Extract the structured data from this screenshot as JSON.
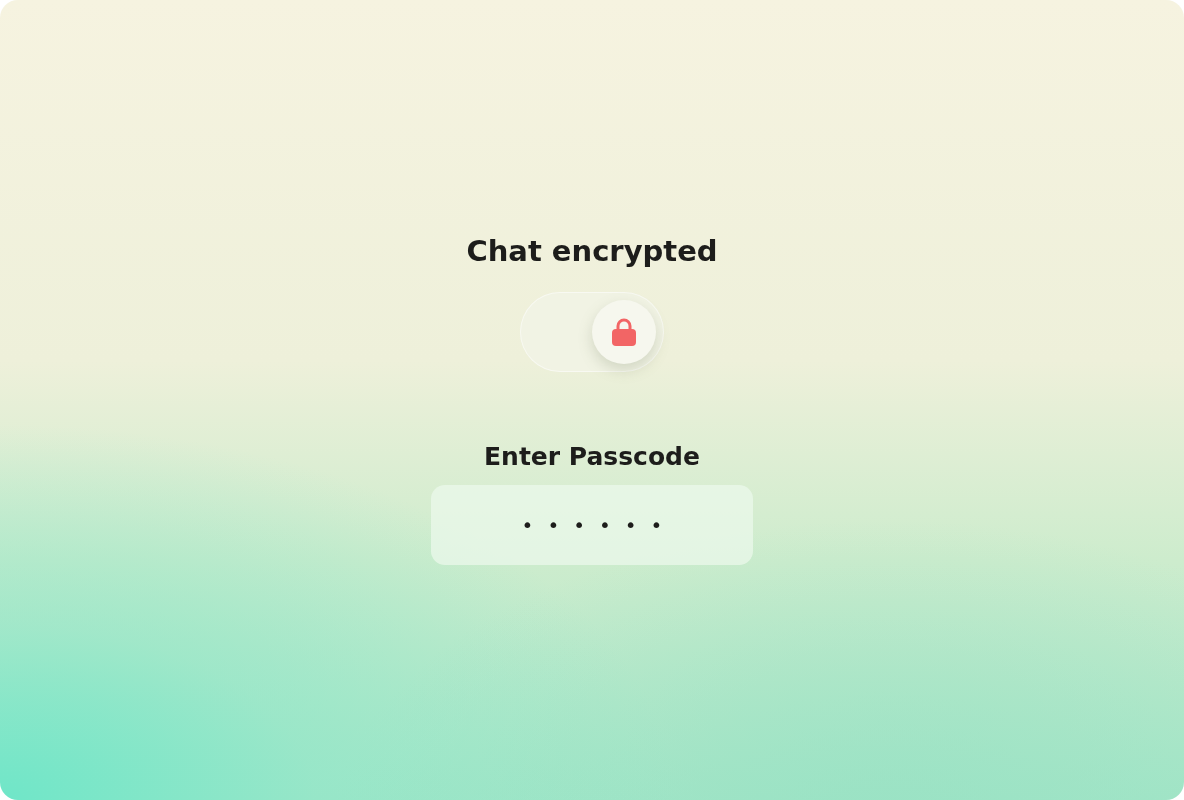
{
  "title": "Chat encrypted",
  "toggle": {
    "on": true
  },
  "passcode": {
    "label": "Enter Passcode",
    "value": "••••••"
  }
}
